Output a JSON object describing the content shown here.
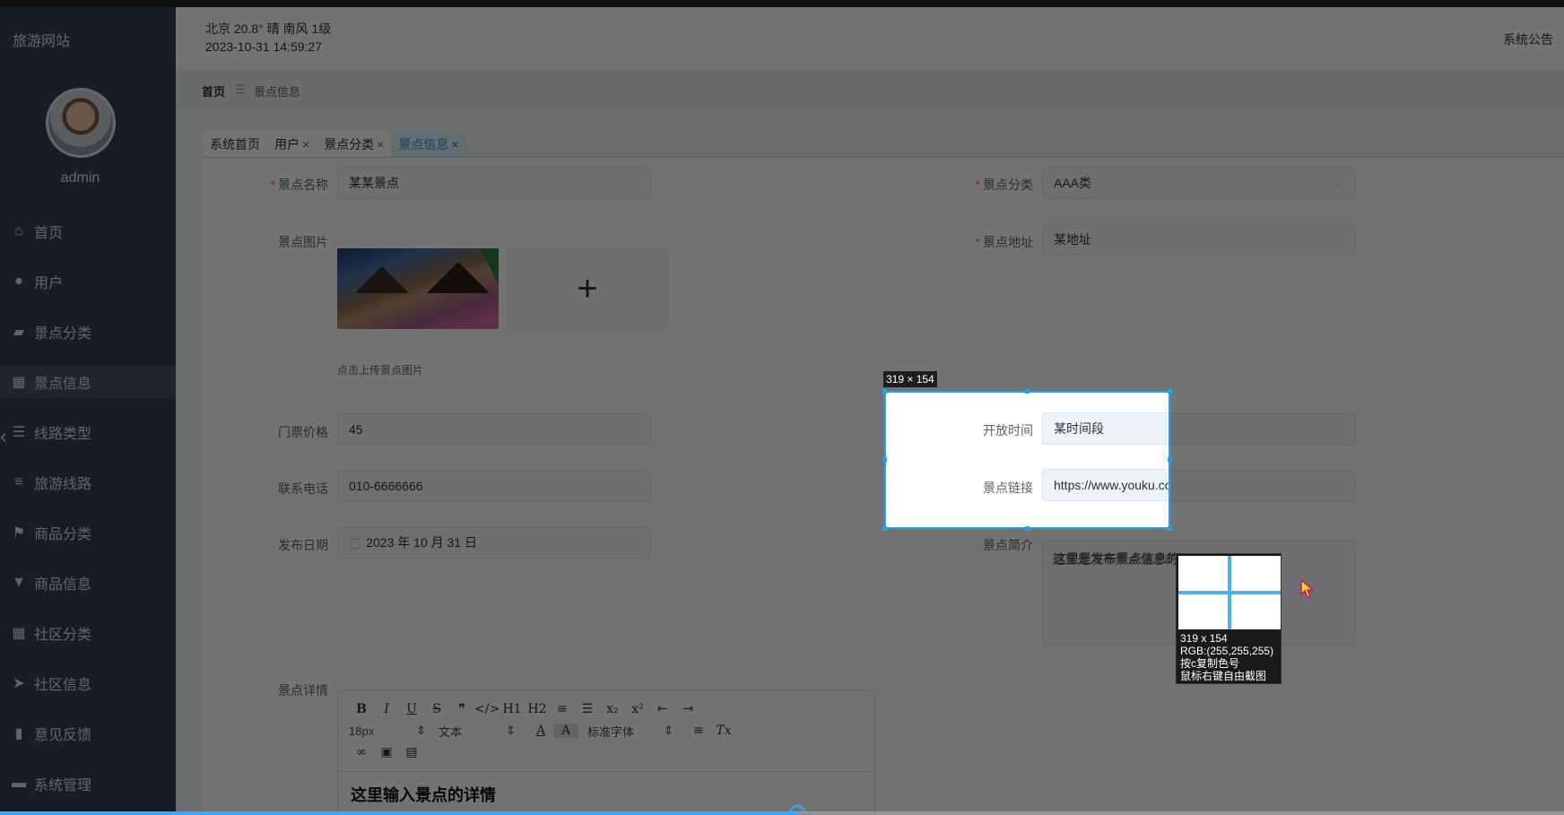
{
  "app": {
    "site_title": "旅游网站",
    "admin_name": "admin"
  },
  "header": {
    "weather": "北京  20.8°  晴  南风  1级",
    "datetime": "2023-10-31 14:59:27",
    "notice": "系统公告"
  },
  "sidebar": {
    "items": [
      {
        "label": "首页",
        "icon": "home-icon"
      },
      {
        "label": "用户",
        "icon": "user-icon"
      },
      {
        "label": "景点分类",
        "icon": "wallet-icon"
      },
      {
        "label": "景点信息",
        "icon": "grid-icon",
        "active": true
      },
      {
        "label": "线路类型",
        "icon": "list-icon"
      },
      {
        "label": "旅游线路",
        "icon": "bars-icon"
      },
      {
        "label": "商品分类",
        "icon": "flag-icon"
      },
      {
        "label": "商品信息",
        "icon": "pin-icon"
      },
      {
        "label": "社区分类",
        "icon": "grid-icon"
      },
      {
        "label": "社区信息",
        "icon": "send-icon"
      },
      {
        "label": "意见反馈",
        "icon": "chart-icon"
      },
      {
        "label": "系统管理",
        "icon": "ticket-icon"
      }
    ]
  },
  "breadcrumb": {
    "home": "首页",
    "separator": "☰",
    "current": "景点信息"
  },
  "tabs": [
    {
      "label": "系统首页",
      "closable": false
    },
    {
      "label": "用户",
      "closable": true
    },
    {
      "label": "景点分类",
      "closable": true
    },
    {
      "label": "景点信息",
      "closable": true,
      "active": true
    }
  ],
  "form": {
    "name": {
      "label": "景点名称",
      "value": "某某景点",
      "required": true
    },
    "category": {
      "label": "景点分类",
      "value": "AAA类",
      "required": true
    },
    "image": {
      "label": "景点图片",
      "upload_icon": "plus-icon",
      "tip": "点击上传景点图片"
    },
    "address": {
      "label": "景点地址",
      "value": "某地址",
      "required": true
    },
    "price": {
      "label": "门票价格",
      "value": "45"
    },
    "open_time": {
      "label": "开放时间",
      "value": "某时间段"
    },
    "phone": {
      "label": "联系电话",
      "value": "010-6666666"
    },
    "link": {
      "label": "景点链接",
      "value": "https://www.youku.com/"
    },
    "date": {
      "label": "发布日期",
      "value": "2023 年 10 月 31 日"
    },
    "intro": {
      "label": "景点简介",
      "value": "这里是发布景点信息的"
    },
    "detail": {
      "label": "景点详情",
      "content": "这里输入景点的详情"
    }
  },
  "editor": {
    "toolbar_row1": [
      "B",
      "I",
      "U",
      "S",
      "❞",
      "</>",
      "H1",
      "H2",
      "≡",
      "☰",
      "x₂",
      "x²",
      "⇤",
      "⇥"
    ],
    "font_size": "18px",
    "text_type": "文本",
    "font_family": "标准字体",
    "toolbar_row2_extra": [
      "A",
      "A",
      "≡",
      "Tx"
    ],
    "toolbar_row3": [
      "link-icon",
      "image-icon",
      "video-icon"
    ]
  },
  "capture_tool": {
    "size_badge": "319 × 154",
    "magnifier_lines": [
      "319 x 154",
      "RGB:(255,255,255)",
      "按c复制色号",
      "鼠标右键自由截图"
    ]
  },
  "video": {
    "progress": 0.51
  },
  "colors": {
    "sidebar_bg": "#304156",
    "selection_border": "#2aa0e8",
    "progress": "#3ea6ff"
  }
}
